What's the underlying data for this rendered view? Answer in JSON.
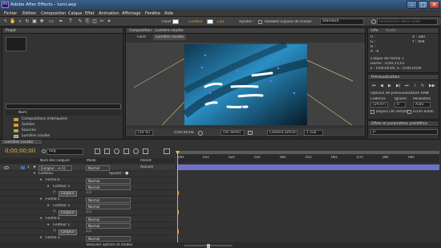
{
  "app": {
    "title": "Adobe After Effects - lumi.aep",
    "window_controls": [
      "–",
      "□",
      "✕"
    ]
  },
  "menu": [
    "Fichier",
    "Edition",
    "Composition",
    "Calque",
    "Effet",
    "Animation",
    "Affichage",
    "Fenêtre",
    "Aide"
  ],
  "toolbar": {
    "fill_label": "Fond",
    "contour_label": "Contour",
    "px_value": "3 px",
    "add_label": "Ajouter :",
    "rotobez_label": "RotoBéz Espace de travail",
    "workspace_value": "Standard",
    "search_placeholder": "Rechercher dans l'aide"
  },
  "project": {
    "tab": "Projet",
    "column": "Nom",
    "items": [
      {
        "name": "Compositions imbriquées",
        "type": "folder"
      },
      {
        "name": "Solides",
        "type": "folder"
      },
      {
        "name": "Sources",
        "type": "folder"
      },
      {
        "name": "Lumière courbe",
        "type": "comp"
      }
    ],
    "footer": "8 bpc"
  },
  "composition": {
    "tab": "Composition : Lumière courbe",
    "breadcrumb_root": "Fond",
    "breadcrumb_current": "Lumière courbe",
    "zoom": "(50 %)",
    "timecode": "0;00;00;00",
    "resolution": "(Un demi)",
    "camera": "Caméra active",
    "views": "1 vue"
  },
  "info": {
    "tab_info": "Info",
    "tab_audio": "Audio",
    "r": "R :",
    "g": "G :",
    "b": "B :",
    "a": "A : 0",
    "x": "X : 260",
    "y": "Y : 494",
    "layer_name": "Calque de forme 1",
    "duration": "Durée : 0;00;15;01",
    "range": "E : 0;00;00;00, S : 0;00;10;00"
  },
  "preview": {
    "tab": "Prévisualisation",
    "options_title": "Options de prévisualisation RAM",
    "cadence_label": "Cadence",
    "ignore_label": "Ignorer",
    "resolution_label": "Résolution",
    "cadence_value": "(29,97)",
    "ignore_value": "0",
    "resolution_value": "Auto",
    "from_current": "Depuis cet instant",
    "full_screen": "Ecran entier"
  },
  "effects": {
    "tab": "Effets et paramètres prédéfinis",
    "search_value": "p-"
  },
  "timeline": {
    "tab": "Lumière courbe",
    "timecode": "0;00;00;00",
    "search_value": "larg",
    "col_layer": "Nom des calques",
    "col_mode": "Mode",
    "col_parent": "Parent",
    "ruler": [
      "00s",
      "01s",
      "02s",
      "03s",
      "04s",
      "05s",
      "06s",
      "07s",
      "08s",
      "09s"
    ],
    "layer": {
      "number": "1",
      "name": "[Largeur ...e 1]",
      "mode": "Normal",
      "parent": "Aucune"
    },
    "rows": [
      {
        "indent": 1,
        "label": "Contenu",
        "mode": "",
        "extra": "Ajouter :"
      },
      {
        "indent": 2,
        "label": "Forme 6",
        "mode": "Normal"
      },
      {
        "indent": 3,
        "label": "Contour 1",
        "mode": "Normal"
      },
      {
        "indent": 4,
        "label": "Largeur",
        "mode": "",
        "extra": "3,0",
        "keyframe": true
      },
      {
        "indent": 2,
        "label": "Forme 5",
        "mode": "Normal"
      },
      {
        "indent": 3,
        "label": "Contour 1",
        "mode": "Normal"
      },
      {
        "indent": 4,
        "label": "Largeur",
        "mode": "",
        "extra": "3,0",
        "keyframe": true
      },
      {
        "indent": 2,
        "label": "Forme 4",
        "mode": "Normal"
      },
      {
        "indent": 3,
        "label": "Contour 1",
        "mode": "Normal"
      },
      {
        "indent": 4,
        "label": "Largeur",
        "mode": "",
        "extra": "3,0",
        "keyframe": true
      },
      {
        "indent": 2,
        "label": "Forme 3",
        "mode": "Normal"
      },
      {
        "indent": 3,
        "label": "Contour 1",
        "mode": "Normal"
      }
    ],
    "footer": "Basculer options et modes"
  }
}
